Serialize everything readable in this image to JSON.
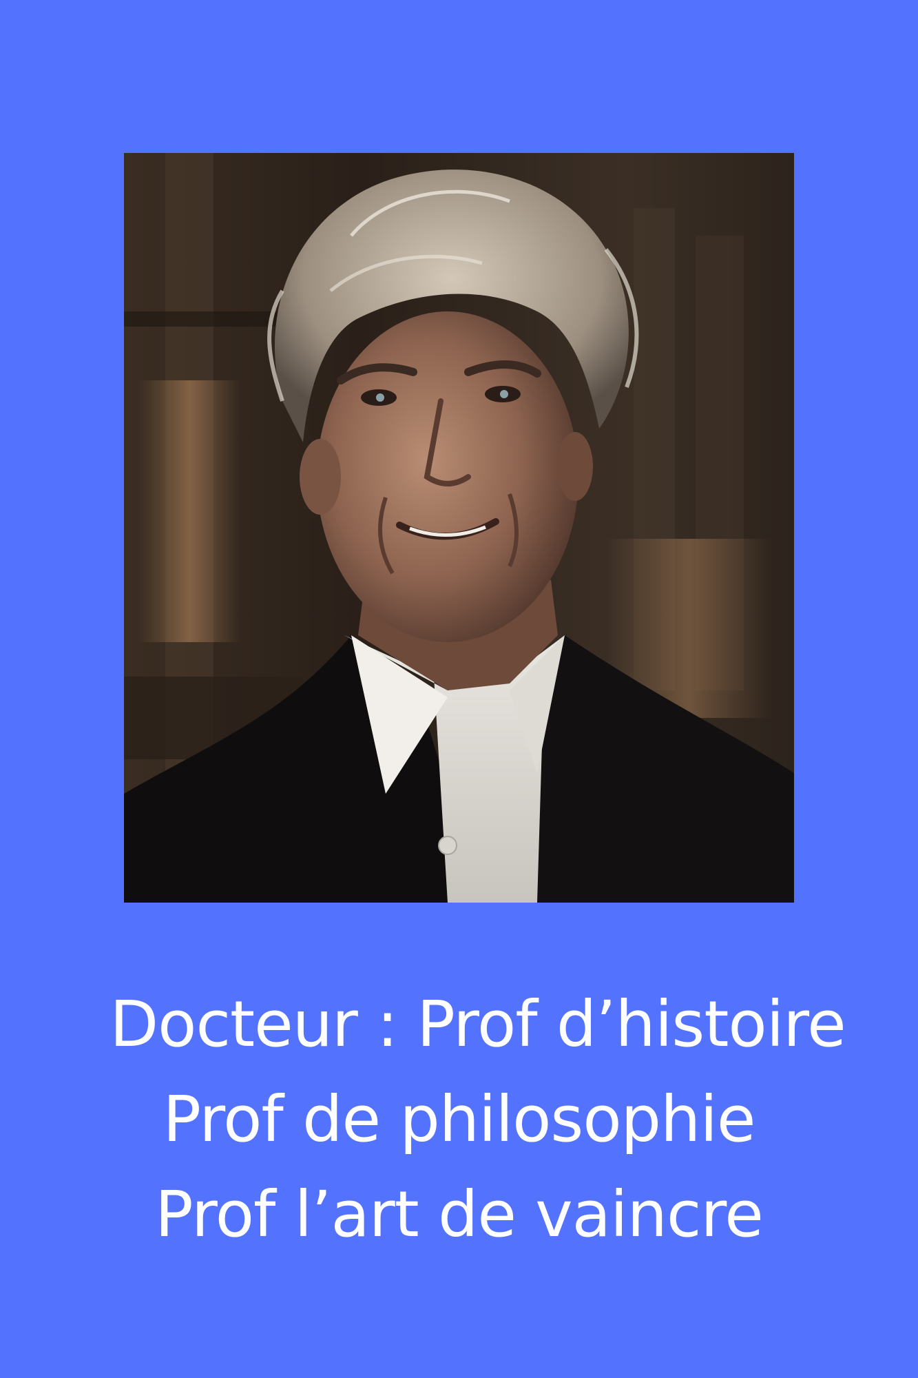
{
  "theme": {
    "background_color": "#5373ff",
    "text_color": "#ffffff"
  },
  "photo": {
    "subject": "smiling man with wild grey hair, dark jacket and white shirt, dim interior background"
  },
  "caption": {
    "lines": [
      "Docteur : Prof d’histoire",
      "Prof de philosophie",
      "Prof l’art de vaincre"
    ]
  }
}
